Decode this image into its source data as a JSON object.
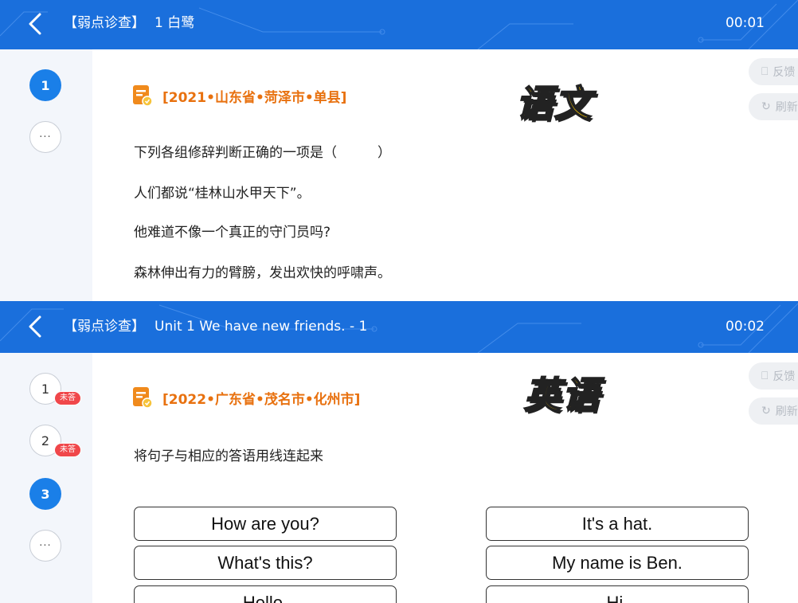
{
  "panels": [
    {
      "header": {
        "title_prefix": "【弱点诊查】",
        "title_main": "1 白鹭",
        "timer": "00:01"
      },
      "sidebar": {
        "questions": [
          {
            "label": "1",
            "state": "active",
            "badge": ""
          },
          {
            "label": "···",
            "state": "more",
            "badge": ""
          }
        ]
      },
      "source": "[2021•山东省•菏泽市•单县]",
      "subject_label": "语文",
      "lines": [
        "下列各组修辞判断正确的一项是（　　　）",
        "人们都说“桂林山水甲天下”。",
        "他难道不像一个真正的守门员吗?",
        "森林伸出有力的臂膀，发出欢快的呼啸声。"
      ],
      "side_buttons": [
        {
          "label": "反馈",
          "icon": "feedback-icon"
        },
        {
          "label": "刷新",
          "icon": "refresh-icon"
        }
      ]
    },
    {
      "header": {
        "title_prefix": "【弱点诊查】",
        "title_main": "Unit 1 We have new friends. - 1",
        "timer": "00:02"
      },
      "sidebar": {
        "questions": [
          {
            "label": "1",
            "state": "idle",
            "badge": "未答"
          },
          {
            "label": "2",
            "state": "idle",
            "badge": "未答"
          },
          {
            "label": "3",
            "state": "active",
            "badge": ""
          },
          {
            "label": "···",
            "state": "more",
            "badge": ""
          }
        ]
      },
      "source": "[2022•广东省•茂名市•化州市]",
      "subject_label": "英语",
      "lines": [
        "将句子与相应的答语用线连起来"
      ],
      "match_left": [
        "How are you?",
        "What's this?",
        "Hello."
      ],
      "match_right": [
        "It's a hat.",
        "My name is Ben.",
        "Hi."
      ],
      "side_buttons": [
        {
          "label": "反馈",
          "icon": "feedback-icon"
        },
        {
          "label": "刷新",
          "icon": "refresh-icon"
        }
      ]
    }
  ],
  "colors": {
    "header_blue": "#1a6fdc",
    "accent_orange": "#e8710f",
    "active_blue": "#1a7fe8",
    "badge_red": "#f0474a",
    "label_yellow": "#f7c600"
  }
}
